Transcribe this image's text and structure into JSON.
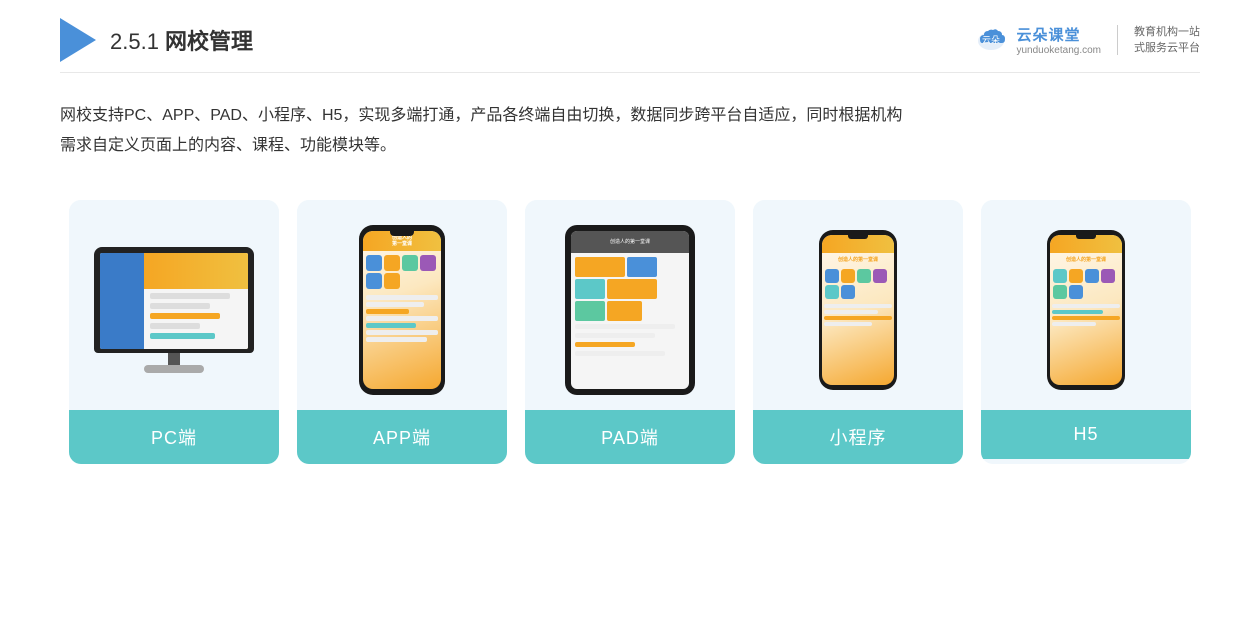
{
  "header": {
    "title_prefix": "2.5.1 ",
    "title_main": "网校管理",
    "brand": {
      "name": "云朵课堂",
      "url": "yunduoketang.com",
      "slogan_line1": "教育机构一站",
      "slogan_line2": "式服务云平台"
    }
  },
  "description": {
    "line1": "网校支持PC、APP、PAD、小程序、H5，实现多端打通，产品各终端自由切换，数据同步跨平台自适应，同时根据机构",
    "line2": "需求自定义页面上的内容、课程、功能模块等。"
  },
  "cards": [
    {
      "id": "pc",
      "label": "PC端",
      "device_type": "pc"
    },
    {
      "id": "app",
      "label": "APP端",
      "device_type": "phone"
    },
    {
      "id": "pad",
      "label": "PAD端",
      "device_type": "tablet"
    },
    {
      "id": "miniprogram",
      "label": "小程序",
      "device_type": "mini_phone"
    },
    {
      "id": "h5",
      "label": "H5",
      "device_type": "mini_phone"
    }
  ]
}
